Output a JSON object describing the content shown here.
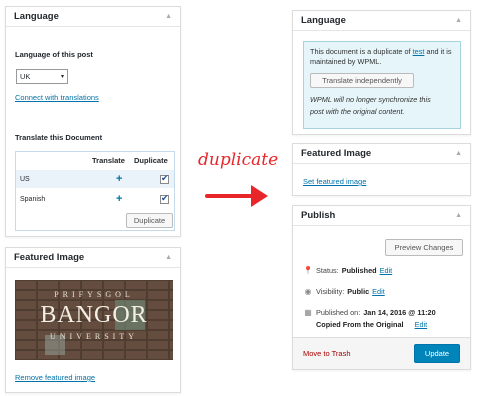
{
  "left_language": {
    "title": "Language",
    "lang_of_post_label": "Language of this post",
    "lang_select_value": "UK",
    "connect_link": "Connect with translations",
    "translate_doc_label": "Translate this Document",
    "col_translate": "Translate",
    "col_duplicate": "Duplicate",
    "rows": [
      {
        "lang": "US"
      },
      {
        "lang": "Spanish"
      }
    ],
    "duplicate_button": "Duplicate"
  },
  "left_featured": {
    "title": "Featured Image",
    "image_text_top": "PRIFYSGOL",
    "image_text_main": "BANGOR",
    "image_text_bottom": "UNIVERSITY",
    "remove_link": "Remove featured image"
  },
  "middle": {
    "label": "duplicate",
    "arrow_color": "#e8262a"
  },
  "right_language": {
    "title": "Language",
    "notice_prefix": "This document is a duplicate of",
    "notice_link": "test",
    "notice_suffix": "and it is maintained by WPML.",
    "translate_button": "Translate independently",
    "notice_italic_1": "WPML will no longer synchronize this",
    "notice_italic_2": "post with the original content."
  },
  "right_featured": {
    "title": "Featured Image",
    "set_link": "Set featured image"
  },
  "publish": {
    "title": "Publish",
    "preview_button": "Preview Changes",
    "status_label": "Status:",
    "status_value": "Published",
    "visibility_label": "Visibility:",
    "visibility_value": "Public",
    "published_label": "Published on:",
    "published_value": "Jan 14, 2016 @ 11:20",
    "copied_label": "Copied From the Original",
    "edit_label": "Edit",
    "trash_link": "Move to Trash",
    "update_button": "Update",
    "accent_color": "#0085ba"
  }
}
